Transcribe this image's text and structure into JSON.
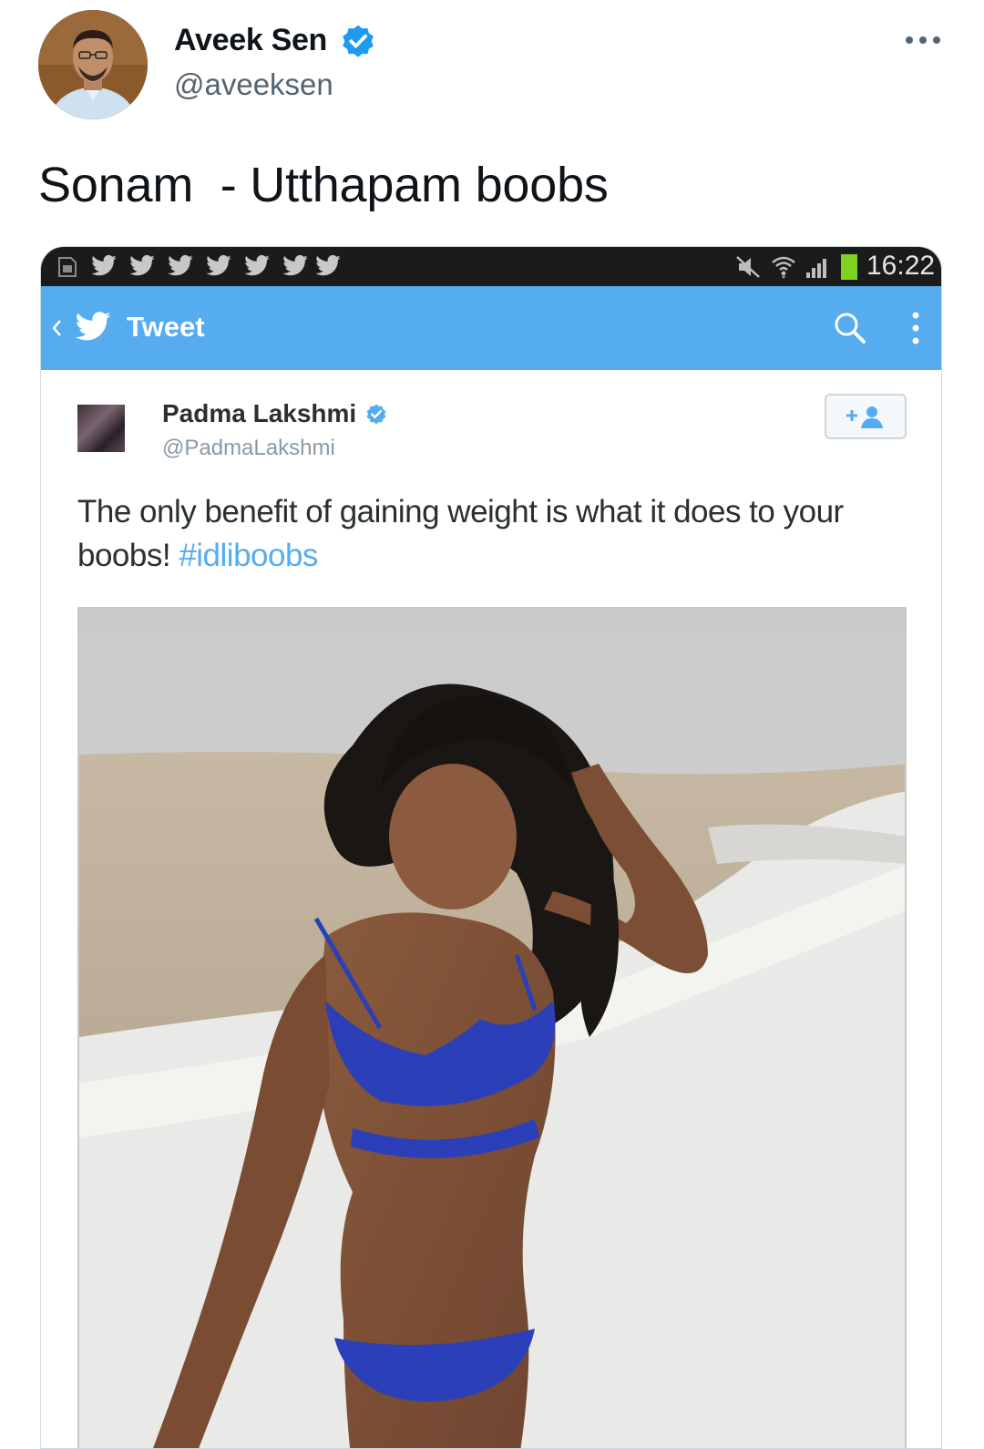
{
  "author": {
    "name": "Aveek Sen",
    "handle": "@aveeksen",
    "verified": true,
    "verified_color": "#1d9bf0"
  },
  "tweet": {
    "text": "Sonam  - Utthapam boobs"
  },
  "more_icon": "more-horizontal-icon",
  "screenshot": {
    "statusbar": {
      "time": "16:22",
      "notification_icons": [
        "twitter-bird-icon",
        "twitter-bird-icon",
        "twitter-bird-icon",
        "twitter-bird-icon",
        "twitter-bird-icon",
        "twitter-bird-icon",
        "twitter-bird-icon"
      ],
      "battery_color": "#7ed321"
    },
    "appbar": {
      "title": "Tweet",
      "color": "#55acee"
    },
    "inner_tweet": {
      "name": "Padma Lakshmi",
      "handle": "@PadmaLakshmi",
      "text": "The only benefit of gaining weight is what it does to your boobs! ",
      "hashtag": "#idliboobs",
      "hashtag_color": "#55acee"
    }
  }
}
